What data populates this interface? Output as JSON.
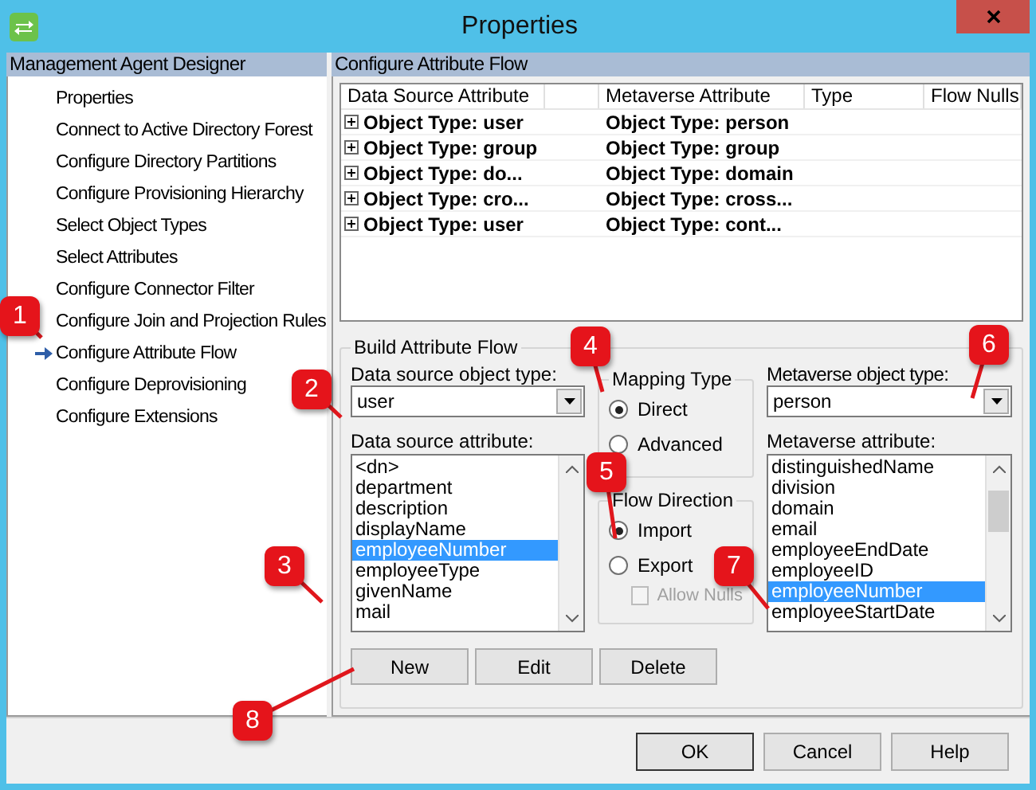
{
  "window": {
    "title": "Properties"
  },
  "sidebar": {
    "title": "Management Agent Designer",
    "items": [
      {
        "label": "Properties",
        "selected": false
      },
      {
        "label": "Connect to Active Directory Forest",
        "selected": false
      },
      {
        "label": "Configure Directory Partitions",
        "selected": false
      },
      {
        "label": "Configure Provisioning Hierarchy",
        "selected": false
      },
      {
        "label": "Select Object Types",
        "selected": false
      },
      {
        "label": "Select Attributes",
        "selected": false
      },
      {
        "label": "Configure Connector Filter",
        "selected": false
      },
      {
        "label": "Configure Join and Projection Rules",
        "selected": false
      },
      {
        "label": "Configure Attribute Flow",
        "selected": true
      },
      {
        "label": "Configure Deprovisioning",
        "selected": false
      },
      {
        "label": "Configure Extensions",
        "selected": false
      }
    ]
  },
  "panel": {
    "title": "Configure Attribute Flow"
  },
  "table": {
    "columns": [
      "Data Source Attribute",
      "Metaverse Attribute",
      "Type",
      "Flow Nulls"
    ],
    "rows": [
      {
        "data_source": "Object Type: user",
        "metaverse": "Object Type: person",
        "expanded": false
      },
      {
        "data_source": "Object Type: group",
        "metaverse": "Object Type: group",
        "expanded": false
      },
      {
        "data_source": "Object Type: do...",
        "metaverse": "Object Type: domain",
        "expanded": false
      },
      {
        "data_source": "Object Type: cro...",
        "metaverse": "Object Type: cross...",
        "expanded": false
      },
      {
        "data_source": "Object Type: user",
        "metaverse": "Object Type: cont...",
        "expanded": false
      }
    ]
  },
  "build": {
    "title": "Build Attribute Flow",
    "ds_type": {
      "label": "Data source object type:",
      "value": "user"
    },
    "ds_attr": {
      "label": "Data source attribute:",
      "items": [
        {
          "label": "<dn>",
          "selected": false
        },
        {
          "label": "department",
          "selected": false
        },
        {
          "label": "description",
          "selected": false
        },
        {
          "label": "displayName",
          "selected": false
        },
        {
          "label": "employeeNumber",
          "selected": true
        },
        {
          "label": "employeeType",
          "selected": false
        },
        {
          "label": "givenName",
          "selected": false
        },
        {
          "label": "mail",
          "selected": false
        }
      ]
    },
    "mapping": {
      "title": "Mapping Type",
      "options": [
        {
          "label": "Direct",
          "selected": true
        },
        {
          "label": "Advanced",
          "selected": false
        }
      ]
    },
    "flow": {
      "title": "Flow Direction",
      "options": [
        {
          "label": "Import",
          "selected": true
        },
        {
          "label": "Export",
          "selected": false
        }
      ],
      "allow_nulls": {
        "label": "Allow Nulls",
        "checked": false,
        "disabled": true
      }
    },
    "mv_type": {
      "label": "Metaverse object type:",
      "value": "person"
    },
    "mv_attr": {
      "label": "Metaverse attribute:",
      "items": [
        {
          "label": "distinguishedName",
          "selected": false
        },
        {
          "label": "division",
          "selected": false
        },
        {
          "label": "domain",
          "selected": false
        },
        {
          "label": "email",
          "selected": false
        },
        {
          "label": "employeeEndDate",
          "selected": false
        },
        {
          "label": "employeeID",
          "selected": false
        },
        {
          "label": "employeeNumber",
          "selected": true
        },
        {
          "label": "employeeStartDate",
          "selected": false
        }
      ]
    },
    "buttons": [
      "New",
      "Edit",
      "Delete"
    ]
  },
  "footer_buttons": [
    "OK",
    "Cancel",
    "Help"
  ],
  "callouts": [
    "1",
    "2",
    "3",
    "4",
    "5",
    "6",
    "7",
    "8"
  ]
}
